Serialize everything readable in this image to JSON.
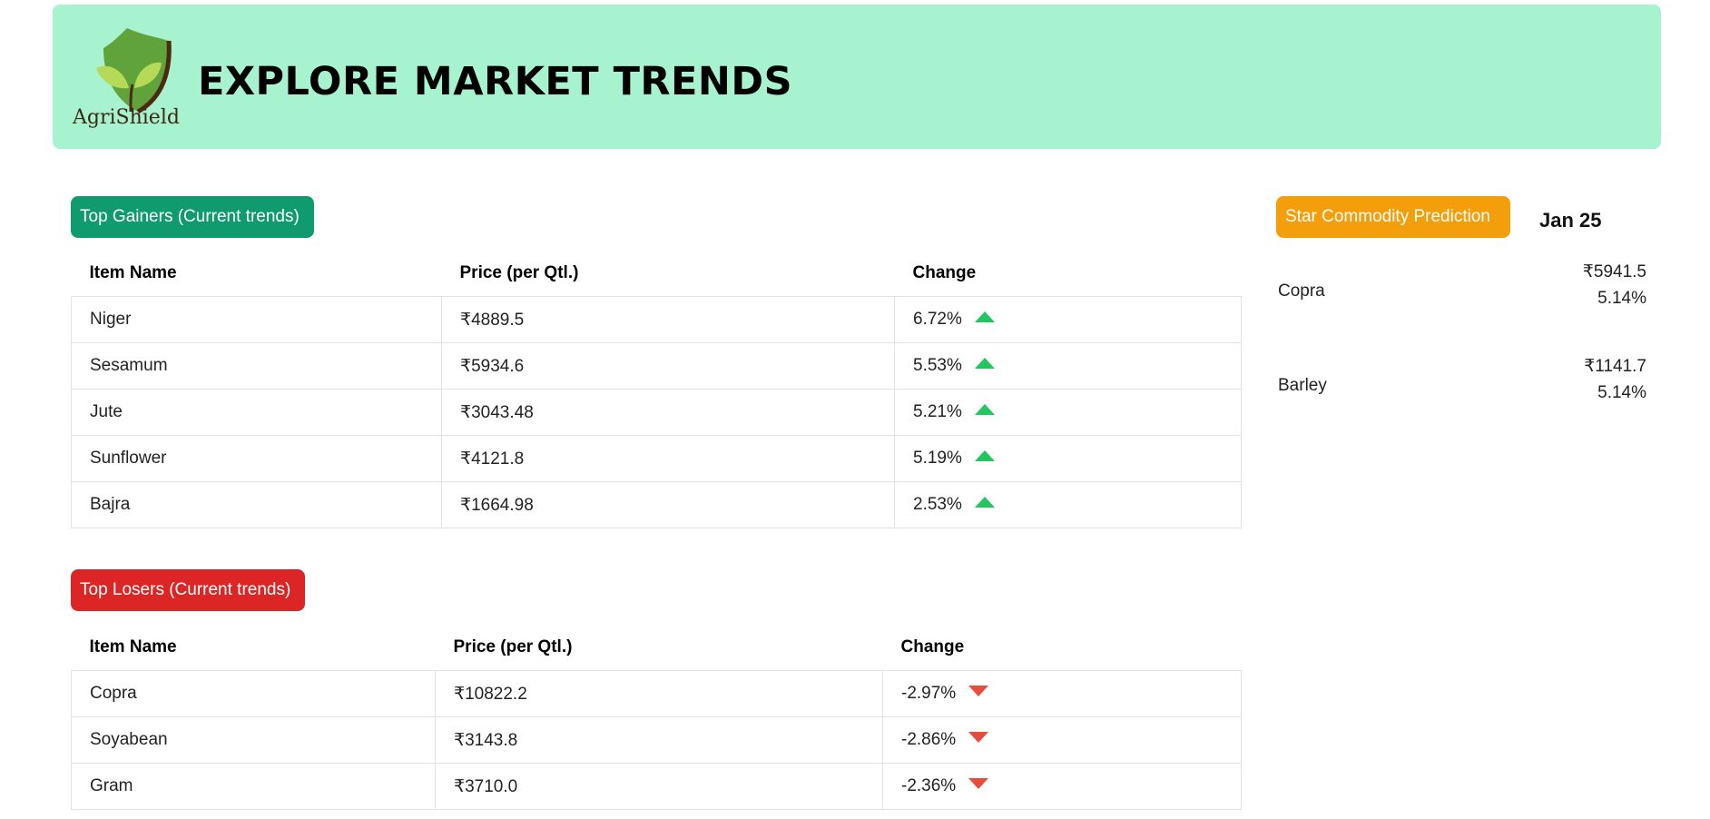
{
  "header": {
    "logo_text": "AgriShield",
    "title": "EXPLORE MARKET TRENDS",
    "background": "#a7f3d0"
  },
  "gainers": {
    "badge": "Top Gainers (Current trends)",
    "badge_color": "#0f9b6e",
    "columns": [
      "Item Name",
      "Price (per Qtl.)",
      "Change"
    ],
    "rows": [
      {
        "name": "Niger",
        "price": "₹4889.5",
        "change": "6.72%"
      },
      {
        "name": "Sesamum",
        "price": "₹5934.6",
        "change": "5.53%"
      },
      {
        "name": "Jute",
        "price": "₹3043.48",
        "change": "5.21%"
      },
      {
        "name": "Sunflower",
        "price": "₹4121.8",
        "change": "5.19%"
      },
      {
        "name": "Bajra",
        "price": "₹1664.98",
        "change": "2.53%"
      }
    ],
    "trend_icon": "arrow-up-icon",
    "trend_color": "#22c55e"
  },
  "losers": {
    "badge": "Top Losers (Current trends)",
    "badge_color": "#dc2626",
    "columns": [
      "Item Name",
      "Price (per Qtl.)",
      "Change"
    ],
    "rows": [
      {
        "name": "Copra",
        "price": "₹10822.2",
        "change": "-2.97%"
      },
      {
        "name": "Soyabean",
        "price": "₹3143.8",
        "change": "-2.86%"
      },
      {
        "name": "Gram",
        "price": "₹3710.0",
        "change": "-2.36%"
      }
    ],
    "trend_icon": "arrow-down-icon",
    "trend_color": "#e74c3c"
  },
  "star": {
    "badge": "Star Commodity Prediction",
    "badge_color": "#f59e0b",
    "date": "Jan 25",
    "items": [
      {
        "name": "Copra",
        "price": "₹5941.5",
        "change": "5.14%"
      },
      {
        "name": "Barley",
        "price": "₹1141.7",
        "change": "5.14%"
      }
    ]
  }
}
